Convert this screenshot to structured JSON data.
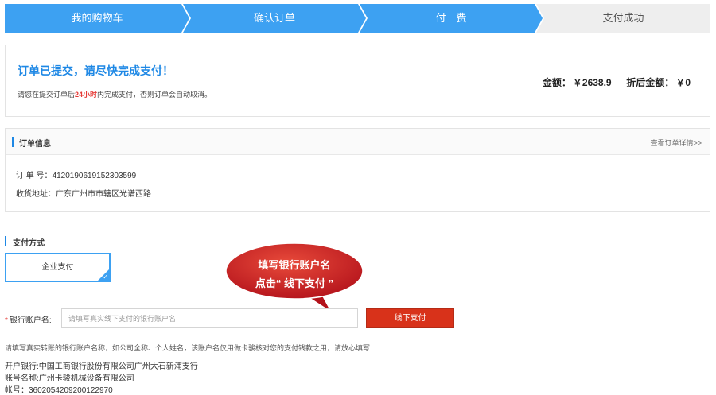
{
  "steps": [
    {
      "label": "我的购物车"
    },
    {
      "label": "确认订单"
    },
    {
      "label": "付　费"
    },
    {
      "label": "支付成功"
    }
  ],
  "submit": {
    "title": "订单已提交，请尽快完成支付！",
    "note_before": "请您在提交订单后",
    "note_highlight": "24小时",
    "note_after": "内完成支付，否则订单会自动取消。",
    "amount_label": "金额：",
    "amount_value": "￥2638.9",
    "discount_label": "折后金额：",
    "discount_value": "￥0"
  },
  "order_info": {
    "title": "订单信息",
    "detail_link": "查看订单详情>>",
    "order_no_label": "订 单 号：",
    "order_no": "4120190619152303599",
    "address_label": "收货地址：",
    "address": "广东广州市市辖区光谱西路"
  },
  "payment": {
    "title": "支付方式",
    "option": "企业支付",
    "accent": "#3da1f2"
  },
  "callout": {
    "line1": "填写银行账户名",
    "line2": "点击“ 线下支付 ”",
    "color": "#d62828"
  },
  "bank_account": {
    "required_mark": "*",
    "label": "银行账户名:",
    "placeholder": "请填写真实线下支付的银行账户名",
    "value": "",
    "button": "线下支付"
  },
  "hint": "请填写真实转账的银行账户名称，如公司全称、个人姓名，该账户名仅用做卡骏核对您的支付钱款之用，请放心填写",
  "bank_info": {
    "line1": "开户银行:中国工商银行股份有限公司广州大石新浦支行",
    "line2": "账号名称:广州卡骏机械设备有限公司",
    "line3": "帐号：3602054209200122970"
  }
}
